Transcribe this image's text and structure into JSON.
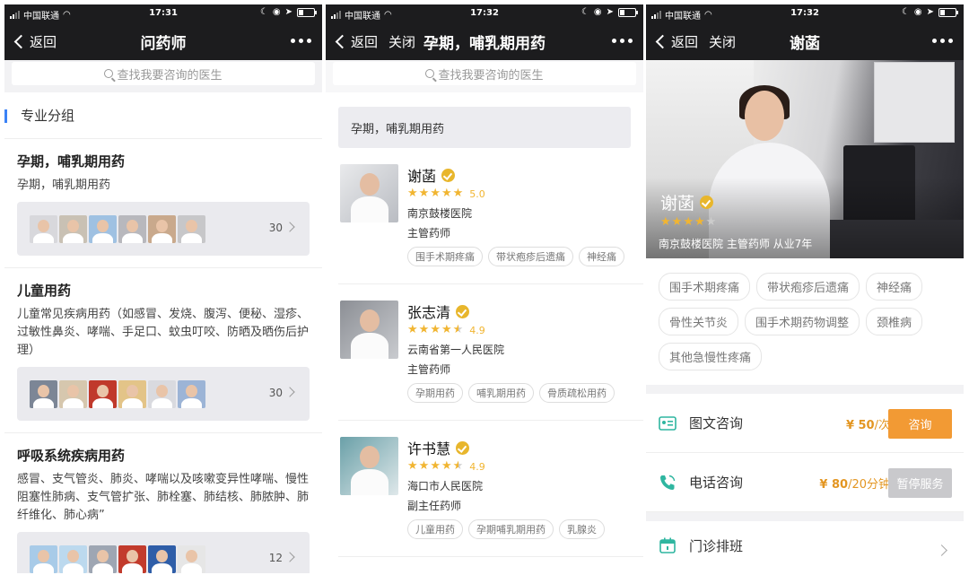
{
  "status": {
    "carrier": "中国联通",
    "time1": "17:31",
    "time2": "17:32",
    "time3": "17:32"
  },
  "nav": {
    "back_label": "返回",
    "close_label": "关闭",
    "title1": "问药师",
    "title2": "孕期，哺乳期用药",
    "title3": "谢菡"
  },
  "search": {
    "placeholder": "查找我要咨询的医生"
  },
  "screen1": {
    "section_title": "专业分组",
    "groups": [
      {
        "title": "孕期，哺乳期用药",
        "desc": "孕期，哺乳期用药",
        "count": "30"
      },
      {
        "title": "儿童用药",
        "desc": "儿童常见疾病用药（如感冒、发烧、腹泻、便秘、湿疹、过敏性鼻炎、哮喘、手足口、蚊虫叮咬、防晒及晒伤后护理）",
        "count": "30"
      },
      {
        "title": "呼吸系统疾病用药",
        "desc": "感冒、支气管炎、肺炎、哮喘以及咳嗽变异性哮喘、慢性阻塞性肺病、支气管扩张、肺栓塞、肺结核、肺脓肿、肺纤维化、肺心病”",
        "count": "12"
      }
    ]
  },
  "screen2": {
    "category_label": "孕期，哺乳期用药",
    "doctors": [
      {
        "name": "谢菡",
        "rating": "5.0",
        "stars": 5,
        "hospital": "南京鼓楼医院",
        "title": "主管药师",
        "tags": [
          "围手术期疼痛",
          "带状疱疹后遗痛",
          "神经痛"
        ]
      },
      {
        "name": "张志清",
        "rating": "4.9",
        "stars": 4.5,
        "hospital": "云南省第一人民医院",
        "title": "主管药师",
        "tags": [
          "孕期用药",
          "哺乳期用药",
          "骨质疏松用药"
        ]
      },
      {
        "name": "许书慧",
        "rating": "4.9",
        "stars": 4.5,
        "hospital": "海口市人民医院",
        "title": "副主任药师",
        "tags": [
          "儿童用药",
          "孕期哺乳期用药",
          "乳腺炎"
        ]
      }
    ]
  },
  "screen3": {
    "doctor_name": "谢菡",
    "stars": 4,
    "info": "南京鼓楼医院  主管药师  从业7年",
    "tags": [
      "围手术期疼痛",
      "带状疱疹后遗痛",
      "神经痛",
      "骨性关节炎",
      "围手术期药物调整",
      "颈椎病",
      "其他急慢性疼痛"
    ],
    "services": [
      {
        "label": "图文咨询",
        "price_main": "¥ 50",
        "price_unit": "/次",
        "button": "咨询"
      },
      {
        "label": "电话咨询",
        "price_main": "¥ 80",
        "price_unit": "/20分钟",
        "button": "暂停服务"
      }
    ],
    "schedule_label": "门诊排班"
  },
  "colors": {
    "accent_blue": "#3b82f6",
    "star": "#f1b531",
    "orange_button": "#f29a34",
    "price": "#e39622",
    "service_icon": "#2fb6a0"
  }
}
